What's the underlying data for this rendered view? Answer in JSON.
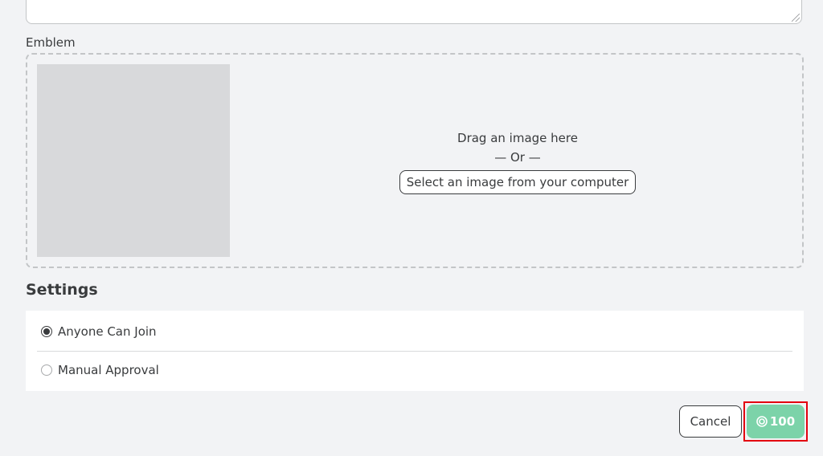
{
  "emblem": {
    "label": "Emblem",
    "drag_text": "Drag an image here",
    "or_text": "— Or —",
    "select_button": "Select an image from your computer"
  },
  "settings": {
    "title": "Settings",
    "options": [
      {
        "label": "Anyone Can Join",
        "selected": true
      },
      {
        "label": "Manual Approval",
        "selected": false
      }
    ]
  },
  "actions": {
    "cancel_label": "Cancel",
    "price": "100",
    "price_icon": "robux-icon",
    "accent_color": "#7cd3a9",
    "highlight_color": "#e3000f"
  }
}
